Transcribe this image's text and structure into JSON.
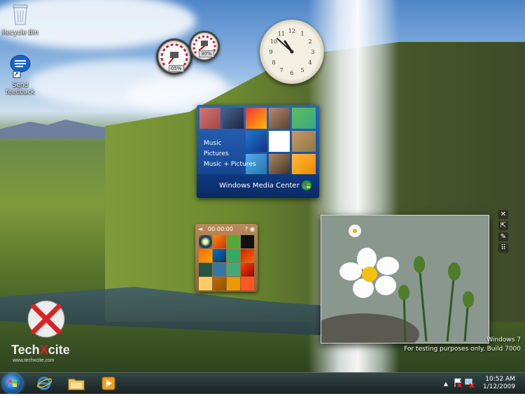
{
  "desktop": {
    "icons": [
      {
        "label": "Recycle Bin",
        "icon": "recycle-bin-icon"
      },
      {
        "label": "Send feedback",
        "icon": "send-feedback-icon"
      }
    ]
  },
  "gadgets": {
    "cpu_meter": {
      "cpu_percent": "05%",
      "memory_percent": "30%"
    },
    "clock": {
      "hour": 10,
      "minute": 52
    },
    "media_center": {
      "menu": [
        "Music",
        "Pictures",
        "Music + Pictures"
      ],
      "brand": "Windows Media Center"
    },
    "puzzle": {
      "timer": "00:00:00",
      "help": "?"
    },
    "slideshow": {
      "tools": [
        "close-icon",
        "pin-icon",
        "wrench-icon",
        "grip-icon"
      ]
    }
  },
  "watermark": {
    "line1": "Windows 7",
    "line2": "For testing purposes only. Build 7000"
  },
  "logo": {
    "name": "TechXcite",
    "url": "www.techxcite.com"
  },
  "taskbar": {
    "pinned": [
      {
        "name": "internet-explorer-icon"
      },
      {
        "name": "windows-explorer-icon"
      },
      {
        "name": "media-player-icon"
      }
    ],
    "time": "10:52 AM",
    "date": "1/12/2009"
  },
  "colors": {
    "taskbar": "#1c2b2b",
    "media_center_blue": "#1a4e9c",
    "puzzle_wood": "#a77747"
  }
}
